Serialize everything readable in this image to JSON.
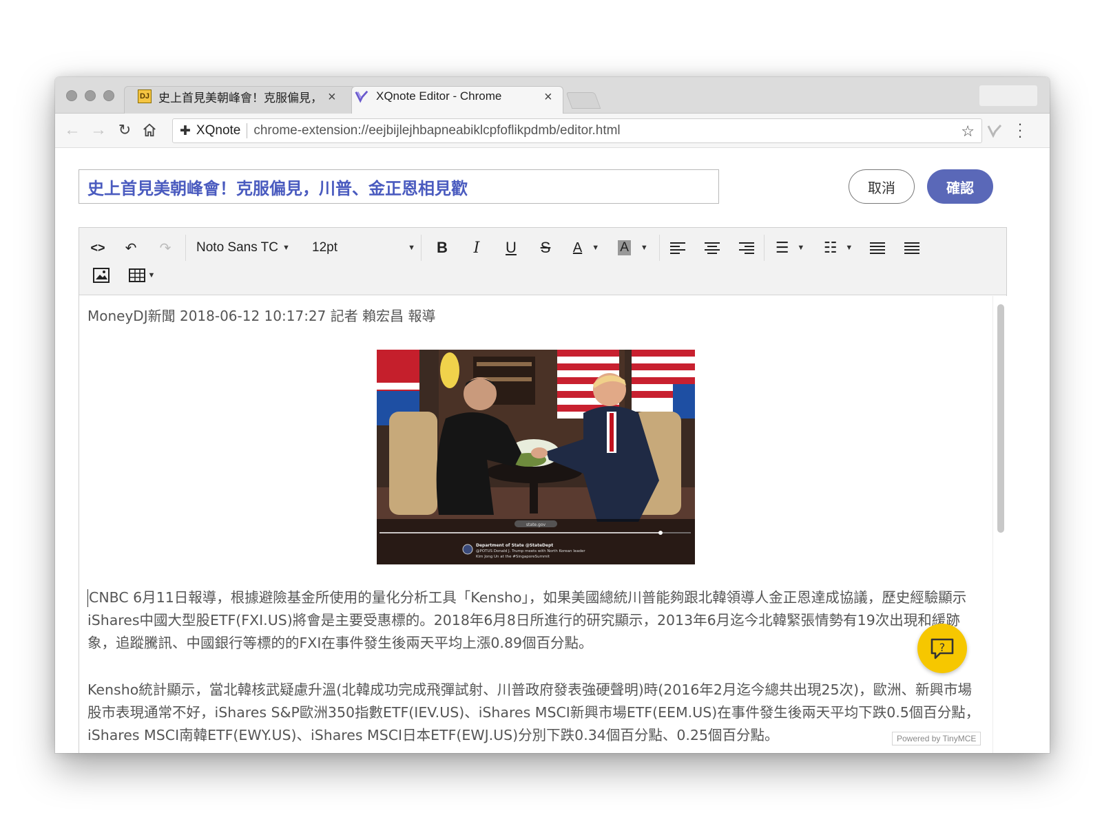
{
  "browser": {
    "tabs": [
      {
        "label": "史上首見美朝峰會！克服偏見，",
        "close": "×",
        "favicon": "DJ"
      },
      {
        "label": "XQnote Editor - Chrome",
        "close": "×"
      }
    ],
    "omnibox": {
      "extension_name": "XQnote",
      "url": "chrome-extension://eejbijlejhbapneabiklcpfoflikpdmb/editor.html"
    },
    "icons": [
      "back-icon",
      "forward-icon",
      "reload-icon",
      "home-icon",
      "puzzle-icon",
      "star-icon",
      "xqnote-extension-icon",
      "menu-icon"
    ]
  },
  "page": {
    "title_value": "史上首見美朝峰會！克服偏見，川普、金正恩相見歡",
    "cancel_label": "取消",
    "confirm_label": "確認",
    "accent_color": "#5a68b8"
  },
  "toolbar": {
    "font_family": "Noto Sans TC",
    "font_size": "12pt",
    "bold": "B",
    "italic": "I",
    "underline": "U",
    "strike": "S",
    "text_color": "A",
    "bg_color": "A"
  },
  "content": {
    "byline": "MoneyDJ新聞 2018-06-12 10:17:27 記者 賴宏昌 報導",
    "photo_caption_line1": "Department of State @StateDept",
    "photo_caption_line2": "@POTUS Donald J. Trump meets with North Korean leader",
    "photo_caption_line3": "Kim Jong Un at the #SingaporeSummit",
    "photo_source": "state.gov",
    "paragraph1": "CNBC 6月11日報導，根據避險基金所使用的量化分析工具「Kensho」，如果美國總統川普能夠跟北韓領導人金正恩達成協議，歷史經驗顯示iShares中國大型股ETF(FXI.US)將會是主要受惠標的。2018年6月8日所進行的研究顯示，2013年6月迄今北韓緊張情勢有19次出現和緩跡象，追蹤騰訊、中國銀行等標的的FXI在事件發生後兩天平均上漲0.89個百分點。",
    "paragraph2": "Kensho統計顯示，當北韓核武疑慮升溫(北韓成功完成飛彈試射、川普政府發表強硬聲明)時(2016年2月迄今總共出現25次)，歐洲、新興市場股市表現通常不好，iShares S&P歐洲350指數ETF(IEV.US)、iShares MSCI新興市場ETF(EEM.US)在事件發生後兩天平均下跌0.5個百分點，iShares MSCI南韓ETF(EWY.US)、iShares MSCI日本ETF(EWJ.US)分別下跌0.34個百分點、0.25個百分點。"
  },
  "footer": {
    "powered_by": "Powered by TinyMCE"
  }
}
